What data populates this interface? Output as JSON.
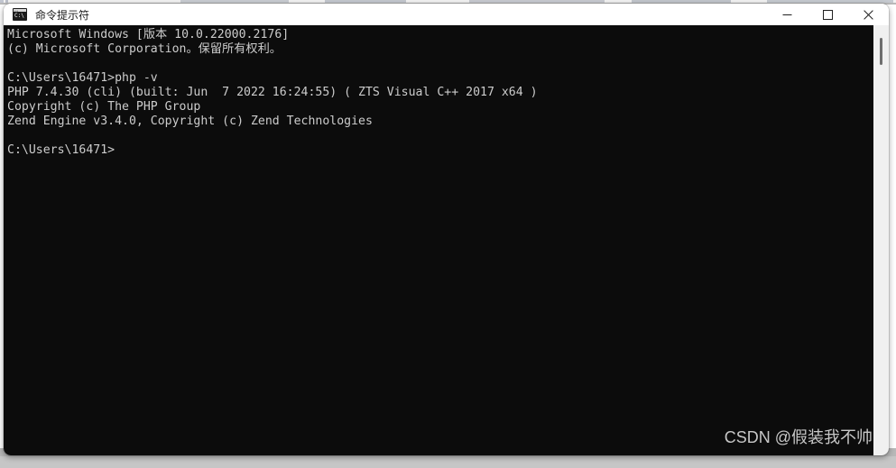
{
  "window": {
    "title": "命令提示符",
    "icon": "cmd-icon",
    "icon_glyph": "C:\\",
    "controls": [
      {
        "name": "minimize",
        "glyph": "—"
      },
      {
        "name": "maximize",
        "glyph": "□"
      },
      {
        "name": "close",
        "glyph": "✕"
      }
    ]
  },
  "console": {
    "lines": [
      "Microsoft Windows [版本 10.0.22000.2176]",
      "(c) Microsoft Corporation。保留所有权利。",
      "",
      "C:\\Users\\16471>php -v",
      "PHP 7.4.30 (cli) (built: Jun  7 2022 16:24:55) ( ZTS Visual C++ 2017 x64 )",
      "Copyright (c) The PHP Group",
      "Zend Engine v3.4.0, Copyright (c) Zend Technologies",
      "",
      "C:\\Users\\16471>"
    ],
    "text": "Microsoft Windows [版本 10.0.22000.2176]\n(c) Microsoft Corporation。保留所有权利。\n\nC:\\Users\\16471>php -v\nPHP 7.4.30 (cli) (built: Jun  7 2022 16:24:55) ( ZTS Visual C++ 2017 x64 )\nCopyright (c) The PHP Group\nZend Engine v3.4.0, Copyright (c) Zend Technologies\n\nC:\\Users\\16471>",
    "prompt": "C:\\Users\\16471>",
    "command": "php -v",
    "background_color": "#0c0c0c",
    "text_color": "#cccccc"
  },
  "watermark": {
    "text": "CSDN @假装我不帅"
  }
}
